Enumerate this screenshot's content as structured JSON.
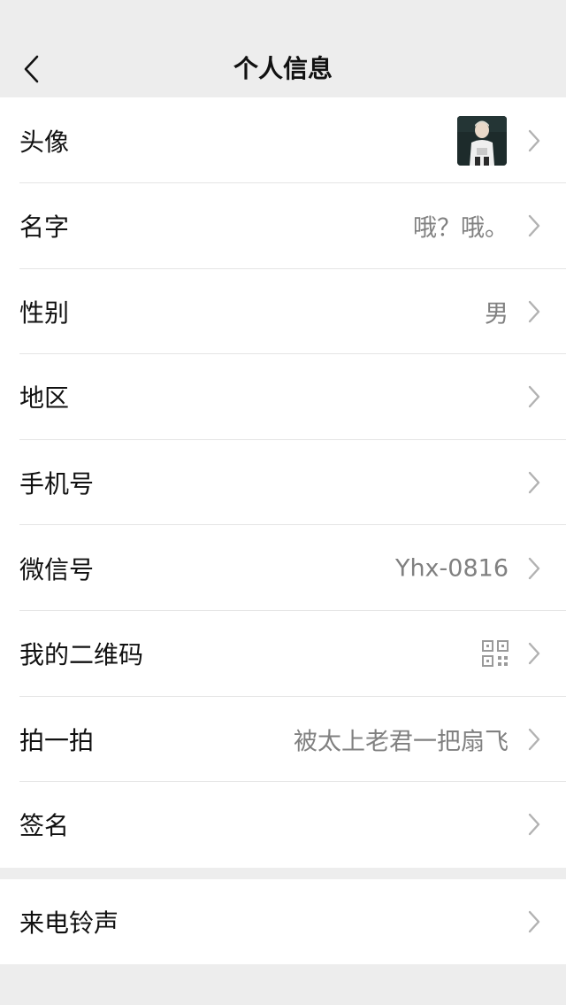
{
  "header": {
    "title": "个人信息"
  },
  "profile_rows": [
    {
      "label": "头像",
      "value": ""
    },
    {
      "label": "名字",
      "value": "哦？哦。"
    },
    {
      "label": "性别",
      "value": "男"
    },
    {
      "label": "地区",
      "value": ""
    },
    {
      "label": "手机号",
      "value": ""
    },
    {
      "label": "微信号",
      "value": "Yhx-0816"
    },
    {
      "label": "我的二维码",
      "value": ""
    },
    {
      "label": "拍一拍",
      "value": "被太上老君一把扇飞"
    },
    {
      "label": "签名",
      "value": ""
    }
  ],
  "extra_rows": [
    {
      "label": "来电铃声",
      "value": ""
    }
  ],
  "icons": {
    "back": "back-arrow-icon",
    "chevron": "chevron-right-icon",
    "qr": "qr-code-icon"
  },
  "colors": {
    "background": "#ededed",
    "row": "#ffffff",
    "label": "#111111",
    "value": "#808080",
    "divider": "#e5e5e5"
  }
}
